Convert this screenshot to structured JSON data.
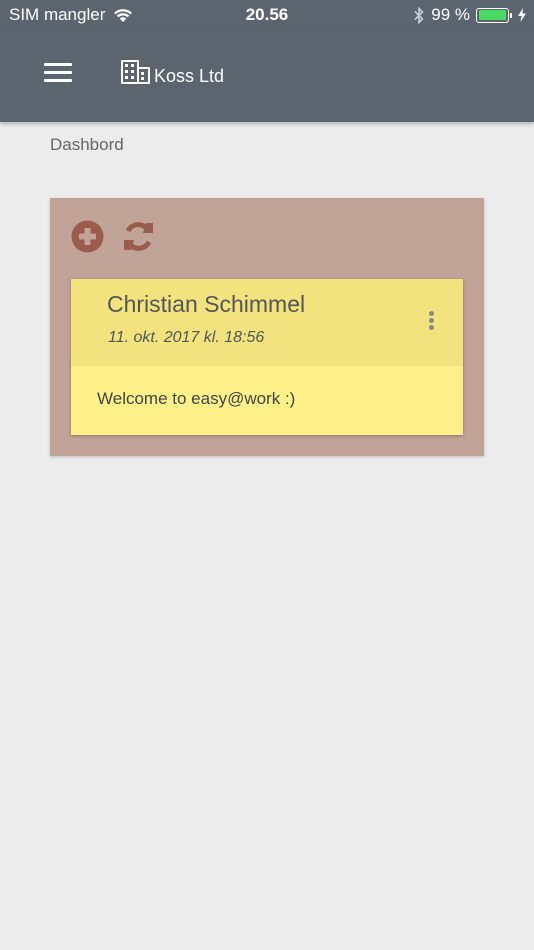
{
  "status_bar": {
    "carrier": "SIM mangler",
    "time": "20.56",
    "battery_percent": "99 %",
    "battery_level": 0.99,
    "icons": [
      "wifi-icon",
      "bluetooth-icon",
      "battery-icon",
      "charging-icon"
    ],
    "battery_color": "#4cd964"
  },
  "app_bar": {
    "company": "Koss Ltd",
    "menu_icon": "hamburger-menu-icon",
    "company_icon": "building-icon",
    "color": "#5b6570"
  },
  "breadcrumb": "Dashbord",
  "board": {
    "color": "#c2a398",
    "toolbar": [
      "add-circle-icon",
      "refresh-icon"
    ],
    "notes": [
      {
        "author": "Christian Schimmel",
        "date": "11. okt. 2017 kl. 18:56",
        "body": "Welcome to easy@work :)",
        "color": "#fff18a",
        "header_color": "#f2e37f"
      }
    ]
  }
}
